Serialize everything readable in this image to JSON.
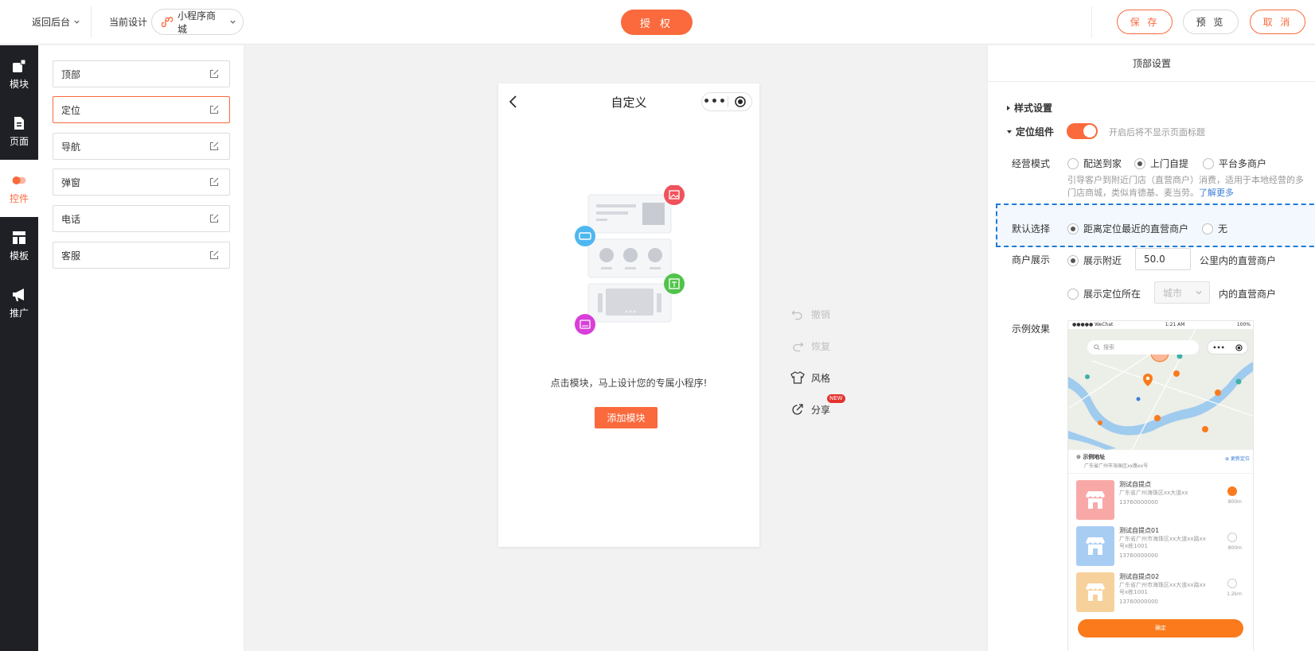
{
  "topbar": {
    "back_label": "返回后台",
    "current_design_label": "当前设计",
    "design_select_value": "小程序商城",
    "authorize_label": "授 权",
    "save_label": "保 存",
    "preview_label": "预 览",
    "cancel_label": "取 消"
  },
  "leftnav": {
    "items": [
      {
        "label": "模块",
        "icon": "module-icon"
      },
      {
        "label": "页面",
        "icon": "page-icon"
      },
      {
        "label": "控件",
        "icon": "toggle-icon"
      },
      {
        "label": "模板",
        "icon": "template-icon"
      },
      {
        "label": "推广",
        "icon": "megaphone-icon"
      }
    ],
    "active": "控件"
  },
  "components": {
    "items": [
      "顶部",
      "定位",
      "导航",
      "弹窗",
      "电话",
      "客服"
    ],
    "active": "定位"
  },
  "phone": {
    "title": "自定义",
    "message": "点击模块，马上设计您的专属小程序!",
    "add_button": "添加模块"
  },
  "actions": {
    "undo": "撤销",
    "redo": "恢复",
    "style": "风格",
    "share": "分享",
    "share_badge": "NEW"
  },
  "settings": {
    "header": "顶部设置",
    "style_section": "样式设置",
    "location_section": "定位组件",
    "location_toggle_on": true,
    "location_hint": "开启后将不显示页面标题",
    "mode_label": "经营模式",
    "mode_options": [
      "配送到家",
      "上门自提",
      "平台多商户"
    ],
    "mode_selected": "上门自提",
    "mode_desc": "引导客户到附近门店（直营商户）消费，适用于本地经营的多门店商城，类似肯德基、麦当劳。",
    "mode_link": "了解更多",
    "default_label": "默认选择",
    "default_options": [
      "距离定位最近的直营商户",
      "无"
    ],
    "default_selected": "距离定位最近的直营商户",
    "merchant_label": "商户展示",
    "nearby_prefix": "展示附近",
    "nearby_value": "50.0",
    "nearby_suffix": "公里内的直营商户",
    "city_prefix": "展示定位所在",
    "city_placeholder": "城市",
    "city_suffix": "内的直营商户",
    "merchant_selected": "nearby",
    "example_label": "示例效果"
  },
  "example": {
    "status_left": "●●●●● WeChat",
    "status_time": "1:21 AM",
    "status_right": "100%",
    "search_placeholder": "搜索",
    "addr_title": "示例地址",
    "addr_detail": "广东省广州市海珠区xx路xx号",
    "relocate": "更新定位",
    "stores": [
      {
        "name": "测试自提点",
        "addr": "广东省广州海珠区xx大道xx",
        "phone": "13760000000",
        "dist": "800m",
        "checked": true,
        "color": "#f9a8a8"
      },
      {
        "name": "测试自提点01",
        "addr": "广东省广州市海珠区xx大道xx路xx号x栋1001",
        "phone": "13760000000",
        "dist": "800m",
        "checked": false,
        "color": "#a8cdf3"
      },
      {
        "name": "测试自提点02",
        "addr": "广东省广州市海珠区xx大道xx路xx号x栋1001",
        "phone": "13760000000",
        "dist": "1.2km",
        "checked": false,
        "color": "#f7d19c"
      }
    ],
    "confirm": "确定"
  },
  "colors": {
    "accent": "#fa6a3c",
    "nav_bg": "#1f2025",
    "link": "#3e7dd8",
    "selection_border": "#1f7ad6"
  }
}
